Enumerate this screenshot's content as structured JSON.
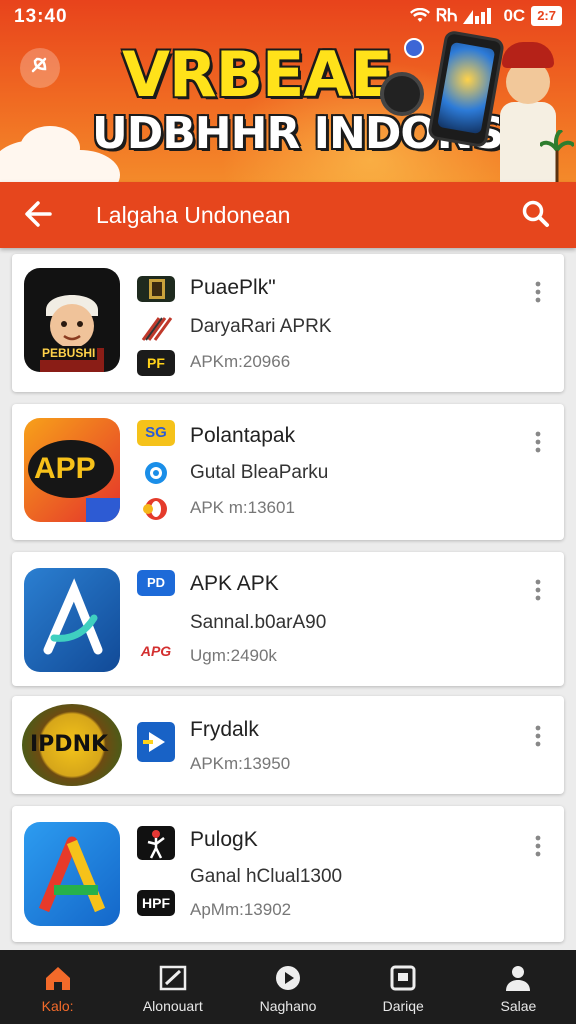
{
  "status_bar": {
    "time": "13:40",
    "right_text": "ᏒᏂ",
    "signal_text": "0C",
    "battery": "2:7"
  },
  "banner": {
    "headline_line1": "VRBEAE",
    "headline_line2": "UDBHHR INDONSIA"
  },
  "toolbar": {
    "title": "Lalgaha Undonean",
    "back_icon": "arrow-left-icon",
    "search_icon": "search-icon"
  },
  "apps": [
    {
      "name": "PuaePlk\"",
      "subtitle": "DaryaRari APRK",
      "meta": "APKm:20966",
      "mini_badge_3": "PF",
      "icon_badge": "PEBUSHI"
    },
    {
      "name": "Polantapak",
      "subtitle": "Gutal BleaParku",
      "meta": "APK m:13601",
      "icon_text": "APP",
      "mini_badge_1": "SG"
    },
    {
      "name": "APK APK",
      "subtitle": "Sannal.b0arA90",
      "meta": "Ugm:2490k",
      "mini_badge_1": "PD",
      "mini_badge_2": "APG"
    },
    {
      "name": "Frydalk",
      "meta": "APKm:13950",
      "icon_text": "IPDNK"
    },
    {
      "name": "PulogK",
      "subtitle": "Ganal hClual1300",
      "meta": "ApMm:13902",
      "mini_badge_2": "HPF"
    }
  ],
  "bottom_nav": [
    {
      "label": "Kalo:",
      "icon": "home-icon",
      "active": true
    },
    {
      "label": "Alonouart",
      "icon": "edit-icon",
      "active": false
    },
    {
      "label": "Naghano",
      "icon": "play-circle-icon",
      "active": false
    },
    {
      "label": "Dariqe",
      "icon": "tv-icon",
      "active": false
    },
    {
      "label": "Salae",
      "icon": "person-icon",
      "active": false
    }
  ],
  "colors": {
    "primary": "#e6461d",
    "banner_yellow": "#ffe21a",
    "nav_bg": "#1d1d1d",
    "nav_active": "#f36a2a"
  }
}
